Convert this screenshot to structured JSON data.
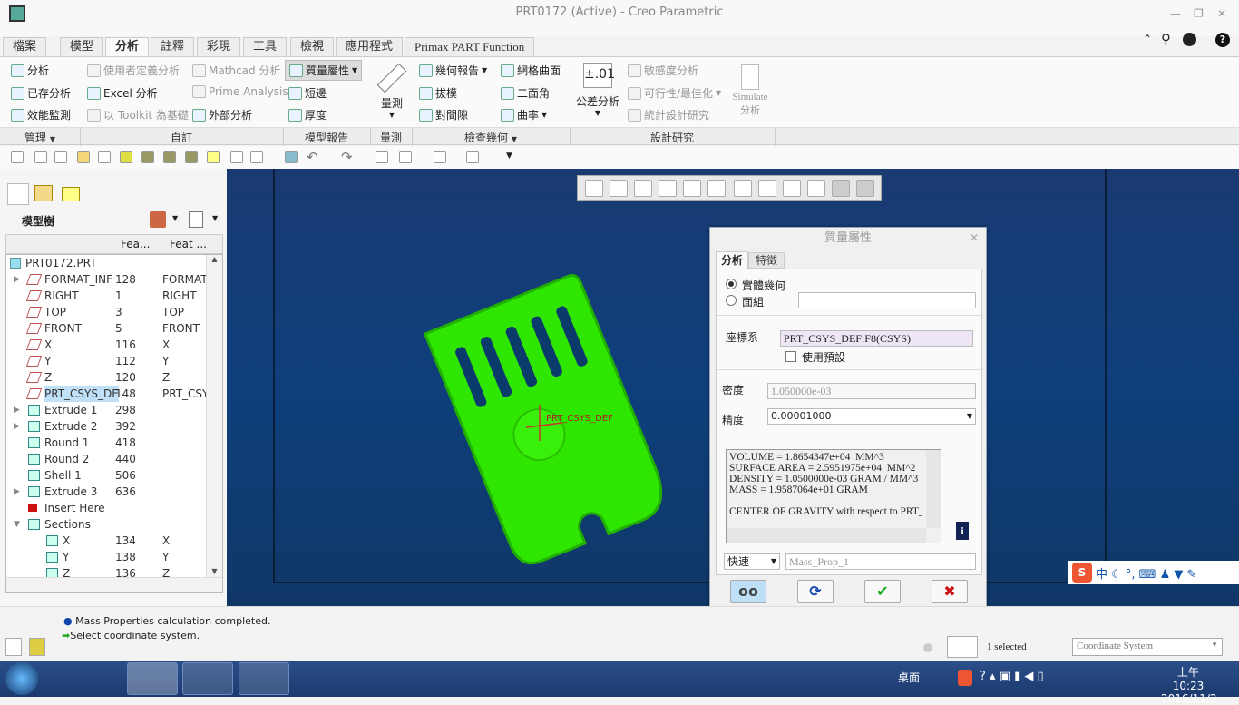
{
  "window": {
    "title": "PRT0172 (Active) - Creo Parametric"
  },
  "tabs": [
    "檔案",
    "模型",
    "分析",
    "註釋",
    "彩現",
    "工具",
    "檢視",
    "應用程式",
    "Primax PART Function"
  ],
  "active_tab": "分析",
  "ribbon": {
    "manage": [
      "分析",
      "已存分析",
      "效能監測"
    ],
    "custom_col1": [
      "使用者定義分析",
      "Excel 分析",
      "以 Toolkit 為基礎"
    ],
    "custom_col2": [
      "Mathcad 分析",
      "Prime Analysis",
      "外部分析"
    ],
    "model_report": [
      "質量屬性",
      "短邊",
      "厚度"
    ],
    "measure": "量測",
    "inspect_col1": [
      "幾何報告",
      "拔模",
      "對間隙"
    ],
    "inspect_col2": [
      "網格曲面",
      "二面角",
      "曲率"
    ],
    "tolerance": "公差分析",
    "tolerance_icon": "±.01",
    "design_study": [
      "敏感度分析",
      "可行性/最佳化",
      "統計設計研究"
    ],
    "simulate": [
      "Simulate",
      "分析"
    ]
  },
  "groups": [
    "管理",
    "自訂",
    "模型報告",
    "量測",
    "檢查幾何",
    "設計研究"
  ],
  "model_tree": {
    "title": "模型樹",
    "columns": [
      "Fea...",
      "Feat ..."
    ],
    "root": "PRT0172.PRT",
    "rows": [
      {
        "name": "FORMAT_INF",
        "id": "128",
        "type": "FORMAT"
      },
      {
        "name": "RIGHT",
        "id": "1",
        "type": "RIGHT"
      },
      {
        "name": "TOP",
        "id": "3",
        "type": "TOP"
      },
      {
        "name": "FRONT",
        "id": "5",
        "type": "FRONT"
      },
      {
        "name": "X",
        "id": "116",
        "type": "X"
      },
      {
        "name": "Y",
        "id": "112",
        "type": "Y"
      },
      {
        "name": "Z",
        "id": "120",
        "type": "Z"
      },
      {
        "name": "PRT_CSYS_DE",
        "id": "148",
        "type": "PRT_CSY"
      },
      {
        "name": "Extrude 1",
        "id": "298",
        "type": ""
      },
      {
        "name": "Extrude 2",
        "id": "392",
        "type": ""
      },
      {
        "name": "Round 1",
        "id": "418",
        "type": ""
      },
      {
        "name": "Round 2",
        "id": "440",
        "type": ""
      },
      {
        "name": "Shell 1",
        "id": "506",
        "type": ""
      },
      {
        "name": "Extrude 3",
        "id": "636",
        "type": ""
      },
      {
        "name": "Insert Here",
        "id": "",
        "type": ""
      },
      {
        "name": "Sections",
        "id": "",
        "type": ""
      },
      {
        "name": "X",
        "id": "134",
        "type": "X"
      },
      {
        "name": "Y",
        "id": "138",
        "type": "Y"
      },
      {
        "name": "Z",
        "id": "136",
        "type": "Z"
      }
    ]
  },
  "viewport": {
    "csys_label": "PRT_CSYS_DEF",
    "model_color": "#33ee00"
  },
  "dialog": {
    "title": "質量屬性",
    "tabs": [
      "分析",
      "特徵"
    ],
    "radio_solid": "實體幾何",
    "radio_quilt": "面組",
    "csys_label": "座標系",
    "csys_value": "PRT_CSYS_DEF:F8(CSYS)",
    "use_default": "使用預設",
    "density_label": "密度",
    "density_value": "1.050000e-03",
    "accuracy_label": "精度",
    "accuracy_value": "0.00001000",
    "results": [
      "VOLUME = 1.8654347e+04  MM^3",
      "SURFACE AREA = 2.5951975e+04  MM^2",
      "DENSITY = 1.0500000e-03 GRAM / MM^3",
      "MASS = 1.9587064e+01 GRAM",
      "",
      "CENTER OF GRAVITY with respect to PRT_"
    ],
    "mode": "快速",
    "name_value": "Mass_Prop_1"
  },
  "status": {
    "messages": [
      "Mass Properties calculation completed.",
      "Select coordinate system."
    ],
    "selected": "1 selected",
    "filter": "Coordinate System"
  },
  "taskbar": {
    "desktop": "桌面",
    "time": "上午 10:23",
    "date": "2016/11/2"
  }
}
